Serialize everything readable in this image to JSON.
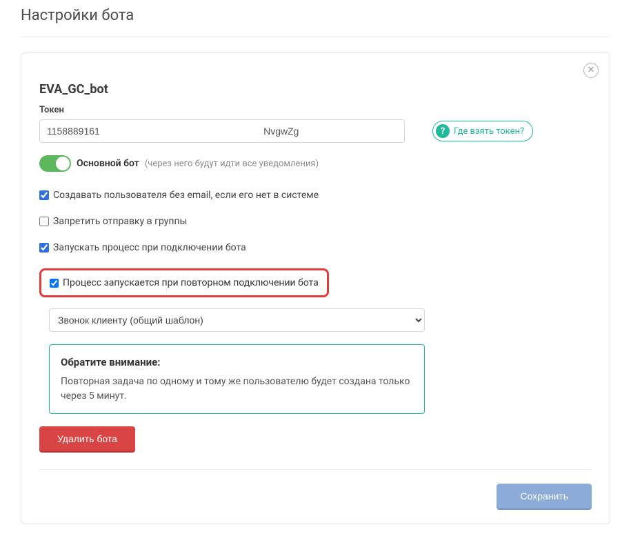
{
  "page": {
    "title": "Настройки бота"
  },
  "card": {
    "bot_name": "EVA_GC_bot",
    "token_label": "Токен",
    "token_value": "1158889161                                                             NvgwZg",
    "help_link": "Где взять токен?",
    "toggle": {
      "label": "Основной бот",
      "hint": "(через него будут идти все уведомления)"
    },
    "checks": {
      "create_user": "Создавать пользователя без email, если его нет в системе",
      "forbid_group": "Запретить отправку в группы",
      "start_process": "Запускать процесс при подключении бота",
      "restart_process": "Процесс запускается при повторном подключении бота"
    },
    "select_value": "Звонок клиенту (общий шаблон)",
    "notice": {
      "title": "Обратите внимание:",
      "body": "Повторная задача по одному и тому же пользователю будет создана только через 5 минут."
    },
    "delete_btn": "Удалить бота",
    "save_btn": "Сохранить"
  }
}
